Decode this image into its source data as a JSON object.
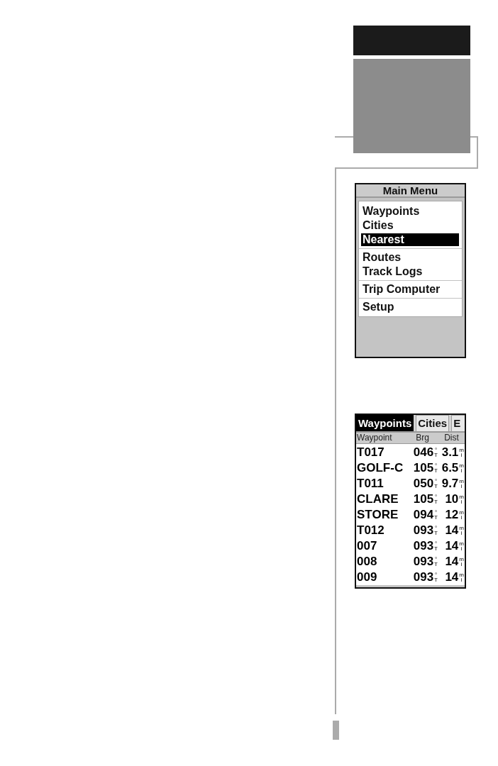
{
  "main_menu": {
    "title": "Main Menu",
    "groups": [
      {
        "items": [
          {
            "label": "Waypoints",
            "selected": false
          },
          {
            "label": "Cities",
            "selected": false
          },
          {
            "label": "Nearest",
            "selected": true
          }
        ]
      },
      {
        "items": [
          {
            "label": "Routes",
            "selected": false
          },
          {
            "label": "Track Logs",
            "selected": false
          }
        ]
      },
      {
        "items": [
          {
            "label": "Trip Computer",
            "selected": false
          }
        ]
      },
      {
        "items": [
          {
            "label": "Setup",
            "selected": false
          }
        ]
      }
    ]
  },
  "nearest_page": {
    "tabs": [
      {
        "label": "Waypoints",
        "selected": true
      },
      {
        "label": "Cities",
        "selected": false
      },
      {
        "label": "E",
        "selected": false
      }
    ],
    "columns": [
      "Waypoint",
      "Brg",
      "Dist"
    ],
    "rows": [
      {
        "name": "T017",
        "bearing": "046",
        "bearing_unit": "°T",
        "distance": "3.1",
        "distance_unit": "mi"
      },
      {
        "name": "GOLF-C",
        "bearing": "105",
        "bearing_unit": "°T",
        "distance": "6.5",
        "distance_unit": "mi"
      },
      {
        "name": "T011",
        "bearing": "050",
        "bearing_unit": "°T",
        "distance": "9.7",
        "distance_unit": "mi"
      },
      {
        "name": "CLARE",
        "bearing": "105",
        "bearing_unit": "°T",
        "distance": "10",
        "distance_unit": "mi"
      },
      {
        "name": "STORE",
        "bearing": "094",
        "bearing_unit": "°T",
        "distance": "12",
        "distance_unit": "mi"
      },
      {
        "name": "T012",
        "bearing": "093",
        "bearing_unit": "°T",
        "distance": "14",
        "distance_unit": "mi"
      },
      {
        "name": "007",
        "bearing": "093",
        "bearing_unit": "°T",
        "distance": "14",
        "distance_unit": "mi"
      },
      {
        "name": "008",
        "bearing": "093",
        "bearing_unit": "°T",
        "distance": "14",
        "distance_unit": "mi"
      },
      {
        "name": "009",
        "bearing": "093",
        "bearing_unit": "°T",
        "distance": "14",
        "distance_unit": "mi"
      }
    ]
  }
}
